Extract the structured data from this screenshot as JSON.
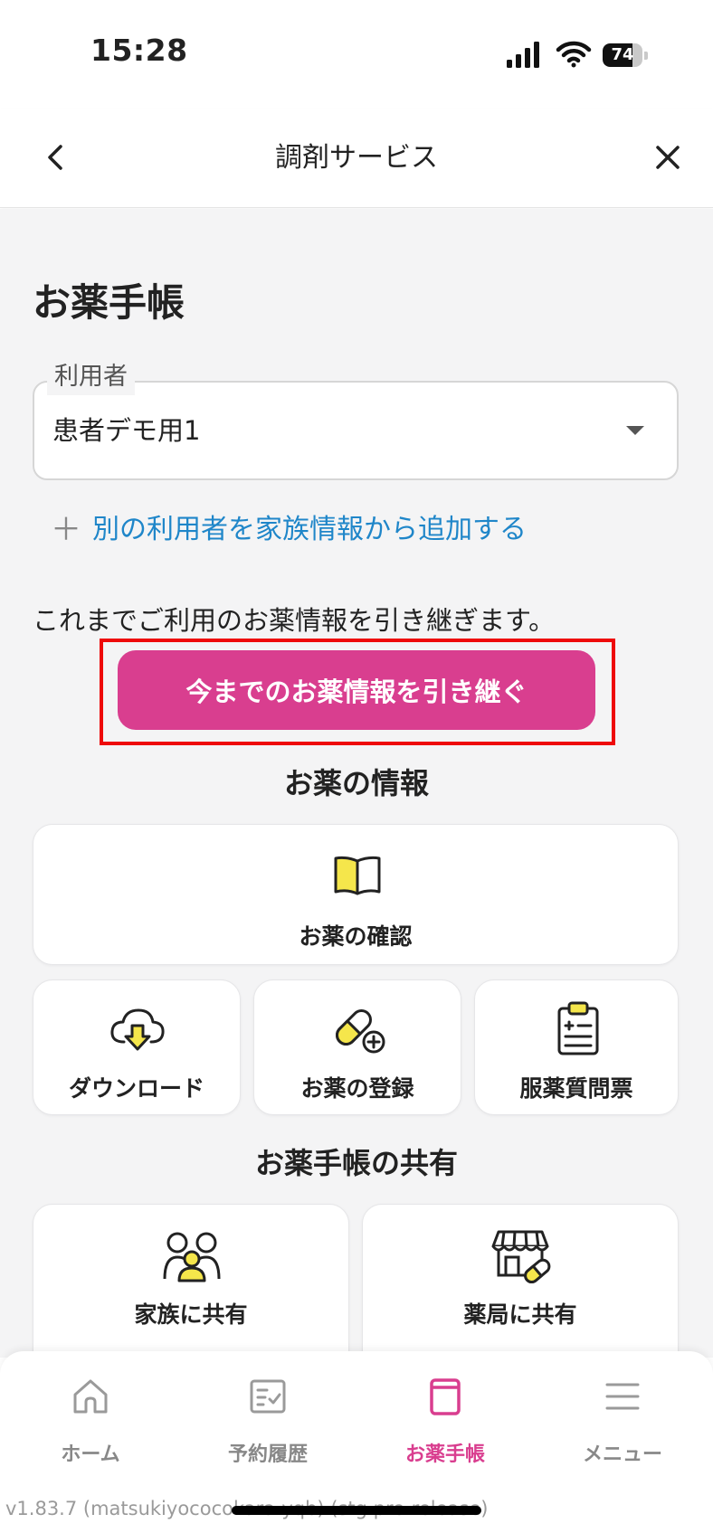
{
  "status_bar": {
    "time": "15:28",
    "battery": "74",
    "battery_level": 0.74
  },
  "header": {
    "title": "調剤サービス",
    "back_icon": "chevron-left-icon",
    "close_icon": "close-icon"
  },
  "page_title": "お薬手帳",
  "user_select": {
    "label": "利用者",
    "value": "患者デモ用1"
  },
  "add_user": {
    "plus": "＋",
    "label": "別の利用者を家族情報から追加する"
  },
  "inherit": {
    "description": "これまでご利用のお薬情報を引き継ぎます。",
    "button_label": "今までのお薬情報を引き継ぐ"
  },
  "medicine_info": {
    "title": "お薬の情報",
    "items": [
      {
        "label": "お薬の確認",
        "icon": "open-book-icon"
      },
      {
        "label": "ダウンロード",
        "icon": "cloud-download-icon"
      },
      {
        "label": "お薬の登録",
        "icon": "capsule-add-icon"
      },
      {
        "label": "服薬質問票",
        "icon": "clipboard-icon"
      }
    ]
  },
  "sharing": {
    "title": "お薬手帳の共有",
    "items": [
      {
        "label": "家族に共有",
        "icon": "family-icon"
      },
      {
        "label": "薬局に共有",
        "icon": "pharmacy-icon"
      }
    ]
  },
  "bottom_nav": {
    "items": [
      {
        "label": "ホーム",
        "icon": "home-icon",
        "active": false
      },
      {
        "label": "予約履歴",
        "icon": "reservation-history-icon",
        "active": false
      },
      {
        "label": "お薬手帳",
        "icon": "medicine-notebook-icon",
        "active": true
      },
      {
        "label": "メニュー",
        "icon": "menu-icon",
        "active": false
      }
    ]
  },
  "version": "v1.83.7 (matsukiyococokara-yqb) (stg.pre-release)",
  "colors": {
    "accent": "#d93e8f",
    "link": "#1f86c9",
    "highlight": "#ee0a0a",
    "icon_yellow": "#f5e64b",
    "background": "#f4f4f5"
  }
}
